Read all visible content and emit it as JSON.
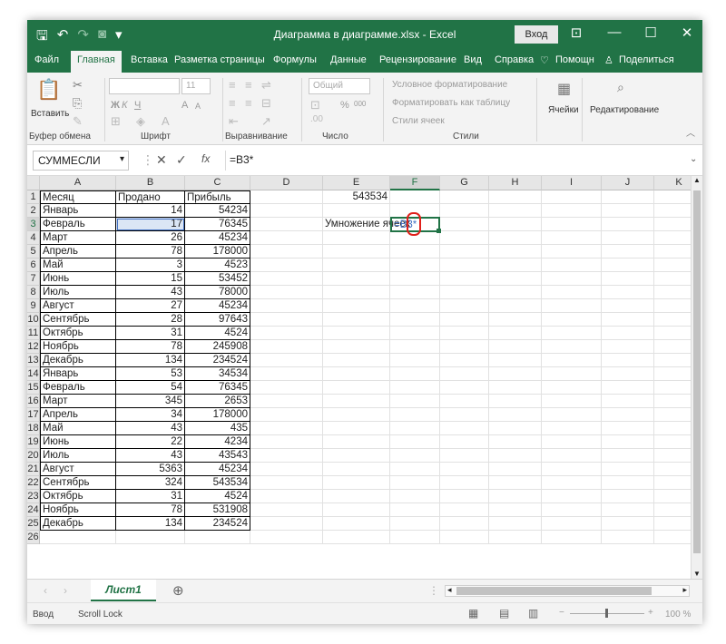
{
  "window": {
    "title": "Диаграмма в диаграмме.xlsx  -  Excel",
    "signin": "Вход",
    "quick_access": [
      "save-icon",
      "undo-icon",
      "redo-icon",
      "camera-icon",
      "customize-icon"
    ],
    "controls": [
      "ribbon-display-icon",
      "minimize-icon",
      "maximize-icon",
      "close-icon"
    ]
  },
  "ribbon_tabs": [
    "Файл",
    "Главная",
    "Вставка",
    "Разметка страницы",
    "Формулы",
    "Данные",
    "Рецензирование",
    "Вид",
    "Справка"
  ],
  "ribbon_right": {
    "tell_me": "Помощн",
    "share": "Поделиться"
  },
  "ribbon": {
    "clipboard": {
      "paste": "Вставить",
      "label": "Буфер обмена"
    },
    "font": {
      "name": "",
      "size": "11",
      "bold": "Ж",
      "italic": "К",
      "underline": "Ч",
      "grow": "A",
      "shrink": "A",
      "label": "Шрифт"
    },
    "alignment": {
      "label": "Выравнивание"
    },
    "number": {
      "format": "Общий",
      "percent": "%",
      "thousands": "000",
      "label": "Число"
    },
    "styles": {
      "conditional": "Условное форматирование",
      "table": "Форматировать как таблицу",
      "cell_styles": "Стили ячеек",
      "label": "Стили"
    },
    "cells": {
      "label": "Ячейки"
    },
    "editing": {
      "label": "Редактирование"
    }
  },
  "formula_bar": {
    "name_box": "СУММЕСЛИ",
    "fx": "fx",
    "formula": "=B3*"
  },
  "columns": [
    "A",
    "B",
    "C",
    "D",
    "E",
    "F",
    "G",
    "H",
    "I",
    "J",
    "K"
  ],
  "headers": {
    "A": "Месяц",
    "B": "Продано",
    "C": "Прибыль"
  },
  "rows": [
    [
      "Январь",
      "14",
      "54234"
    ],
    [
      "Февраль",
      "17",
      "76345"
    ],
    [
      "Март",
      "26",
      "45234"
    ],
    [
      "Апрель",
      "78",
      "178000"
    ],
    [
      "Май",
      "3",
      "4523"
    ],
    [
      "Июнь",
      "15",
      "53452"
    ],
    [
      "Июль",
      "43",
      "78000"
    ],
    [
      "Август",
      "27",
      "45234"
    ],
    [
      "Сентябрь",
      "28",
      "97643"
    ],
    [
      "Октябрь",
      "31",
      "4524"
    ],
    [
      "Ноябрь",
      "78",
      "245908"
    ],
    [
      "Декабрь",
      "134",
      "234524"
    ],
    [
      "Январь",
      "53",
      "34534"
    ],
    [
      "Февраль",
      "54",
      "76345"
    ],
    [
      "Март",
      "345",
      "2653"
    ],
    [
      "Апрель",
      "34",
      "178000"
    ],
    [
      "Май",
      "43",
      "435"
    ],
    [
      "Июнь",
      "22",
      "4234"
    ],
    [
      "Июль",
      "43",
      "43543"
    ],
    [
      "Август",
      "5363",
      "45234"
    ],
    [
      "Сентябрь",
      "324",
      "543534"
    ],
    [
      "Октябрь",
      "31",
      "4524"
    ],
    [
      "Ноябрь",
      "78",
      "531908"
    ],
    [
      "Декабрь",
      "134",
      "234524"
    ]
  ],
  "row_numbers": [
    "1",
    "2",
    "3",
    "4",
    "5",
    "6",
    "7",
    "8",
    "9",
    "10",
    "11",
    "12",
    "13",
    "14",
    "15",
    "16",
    "17",
    "18",
    "19",
    "20",
    "21",
    "22",
    "23",
    "24",
    "25",
    "26"
  ],
  "extra": {
    "e1_value": "543534",
    "e3_label": "Умножение ячеек",
    "f3_editing": "=B3*"
  },
  "sheet": {
    "name": "Лист1",
    "add": "⊕"
  },
  "status": {
    "mode": "Ввод",
    "scroll_lock": "Scroll Lock",
    "zoom": "100 %"
  },
  "colors": {
    "accent": "#217346",
    "selection_ref": "#4472c4",
    "highlight_circle": "#e0201b"
  }
}
